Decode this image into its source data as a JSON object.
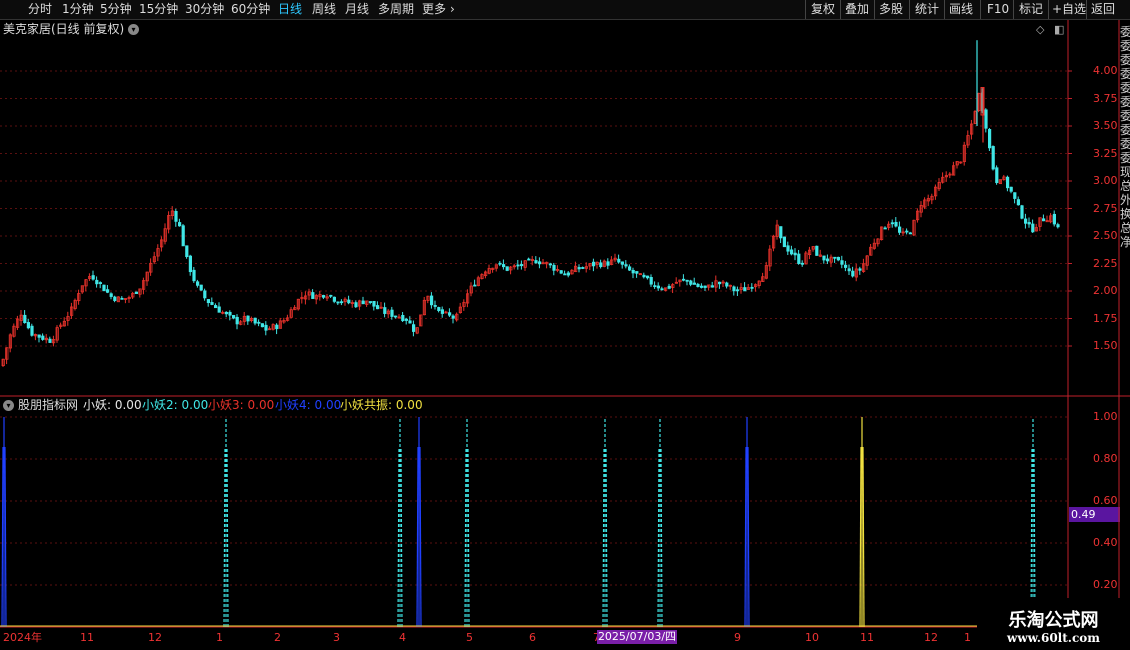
{
  "toolbar": {
    "left_tabs": [
      "分时",
      "1分钟",
      "5分钟",
      "15分钟",
      "30分钟",
      "60分钟",
      "日线",
      "周线",
      "月线",
      "多周期",
      "更多"
    ],
    "active_tab": "日线",
    "right_buttons": [
      "复权",
      "叠加",
      "多股",
      "统计",
      "画线",
      "F10",
      "标记",
      "+自选",
      "返回"
    ]
  },
  "main_chart": {
    "title": "美克家居(日线 前复权)",
    "price_ticks": [
      "4.00",
      "3.75",
      "3.50",
      "3.25",
      "3.00",
      "2.75",
      "2.50",
      "2.25",
      "2.00",
      "1.75",
      "1.50"
    ],
    "up_color": "#e8322b",
    "down_color": "#40e6e6"
  },
  "indicator": {
    "name": "股朋指标网",
    "items": [
      {
        "label": "小妖: 0.00",
        "color": "#e6e6e6"
      },
      {
        "label": "小妖2: 0.00",
        "color": "#40e6e6"
      },
      {
        "label": "小妖3: 0.00",
        "color": "#e8322b"
      },
      {
        "label": "小妖4: 0.00",
        "color": "#2040ff"
      },
      {
        "label": "小妖共振: 0.00",
        "color": "#f0e040"
      }
    ],
    "y_ticks": [
      "1.00",
      "0.80",
      "0.60",
      "0.40",
      "0.20"
    ],
    "cursor_value": "0.49"
  },
  "time_axis": {
    "labels": [
      "2024年",
      "11",
      "12",
      "1",
      "2",
      "3",
      "4",
      "5",
      "6",
      "7",
      "2025/07/03/四",
      "9",
      "10",
      "11",
      "12",
      "1"
    ]
  },
  "right_strip_text": "委委委委委委委委委委现总外换总净",
  "watermark": {
    "line1": "乐淘公式网",
    "line2": "www.60lt.com"
  },
  "chart_data": {
    "type": "candlestick",
    "ylim": [
      1.25,
      4.25
    ],
    "y_ticks": [
      4.0,
      3.75,
      3.5,
      3.25,
      3.0,
      2.75,
      2.5,
      2.25,
      2.0,
      1.75,
      1.5
    ],
    "approx_close_path": [
      [
        0,
        1.32
      ],
      [
        10,
        1.62
      ],
      [
        20,
        1.8
      ],
      [
        30,
        1.62
      ],
      [
        40,
        1.58
      ],
      [
        50,
        1.55
      ],
      [
        60,
        1.7
      ],
      [
        70,
        1.82
      ],
      [
        80,
        2.05
      ],
      [
        90,
        2.15
      ],
      [
        100,
        2.05
      ],
      [
        110,
        1.95
      ],
      [
        120,
        1.92
      ],
      [
        130,
        1.95
      ],
      [
        140,
        2.05
      ],
      [
        150,
        2.25
      ],
      [
        160,
        2.45
      ],
      [
        170,
        2.75
      ],
      [
        178,
        2.6
      ],
      [
        185,
        2.3
      ],
      [
        195,
        2.05
      ],
      [
        205,
        1.92
      ],
      [
        215,
        1.85
      ],
      [
        225,
        1.78
      ],
      [
        235,
        1.72
      ],
      [
        245,
        1.75
      ],
      [
        255,
        1.7
      ],
      [
        265,
        1.65
      ],
      [
        275,
        1.68
      ],
      [
        285,
        1.75
      ],
      [
        295,
        1.9
      ],
      [
        305,
        1.98
      ],
      [
        315,
        1.95
      ],
      [
        325,
        1.98
      ],
      [
        335,
        1.92
      ],
      [
        345,
        1.9
      ],
      [
        355,
        1.88
      ],
      [
        365,
        1.92
      ],
      [
        375,
        1.85
      ],
      [
        385,
        1.8
      ],
      [
        395,
        1.78
      ],
      [
        405,
        1.75
      ],
      [
        415,
        1.62
      ],
      [
        425,
        2.0
      ],
      [
        435,
        1.82
      ],
      [
        445,
        1.78
      ],
      [
        455,
        1.75
      ],
      [
        465,
        1.95
      ],
      [
        475,
        2.1
      ],
      [
        485,
        2.2
      ],
      [
        495,
        2.25
      ],
      [
        505,
        2.2
      ],
      [
        515,
        2.22
      ],
      [
        525,
        2.25
      ],
      [
        535,
        2.28
      ],
      [
        545,
        2.25
      ],
      [
        555,
        2.2
      ],
      [
        565,
        2.15
      ],
      [
        575,
        2.2
      ],
      [
        585,
        2.22
      ],
      [
        595,
        2.25
      ],
      [
        605,
        2.25
      ],
      [
        615,
        2.28
      ],
      [
        625,
        2.2
      ],
      [
        635,
        2.15
      ],
      [
        645,
        2.1
      ],
      [
        655,
        2.05
      ],
      [
        665,
        2.02
      ],
      [
        675,
        2.08
      ],
      [
        685,
        2.1
      ],
      [
        695,
        2.05
      ],
      [
        705,
        2.02
      ],
      [
        715,
        2.08
      ],
      [
        725,
        2.05
      ],
      [
        735,
        2.0
      ],
      [
        745,
        2.02
      ],
      [
        755,
        2.08
      ],
      [
        765,
        2.2
      ],
      [
        775,
        2.6
      ],
      [
        780,
        2.45
      ],
      [
        790,
        2.35
      ],
      [
        800,
        2.25
      ],
      [
        810,
        2.4
      ],
      [
        820,
        2.3
      ],
      [
        830,
        2.28
      ],
      [
        840,
        2.25
      ],
      [
        850,
        2.15
      ],
      [
        860,
        2.2
      ],
      [
        870,
        2.4
      ],
      [
        880,
        2.55
      ],
      [
        890,
        2.65
      ],
      [
        900,
        2.5
      ],
      [
        910,
        2.55
      ],
      [
        920,
        2.8
      ],
      [
        930,
        2.85
      ],
      [
        940,
        3.0
      ],
      [
        950,
        3.1
      ],
      [
        960,
        3.2
      ],
      [
        970,
        3.5
      ],
      [
        978,
        3.8
      ],
      [
        985,
        3.5
      ],
      [
        990,
        3.2
      ],
      [
        995,
        3.0
      ],
      [
        1000,
        3.05
      ],
      [
        1010,
        2.9
      ],
      [
        1020,
        2.7
      ],
      [
        1030,
        2.55
      ],
      [
        1040,
        2.65
      ],
      [
        1050,
        2.68
      ],
      [
        1058,
        2.55
      ]
    ]
  }
}
